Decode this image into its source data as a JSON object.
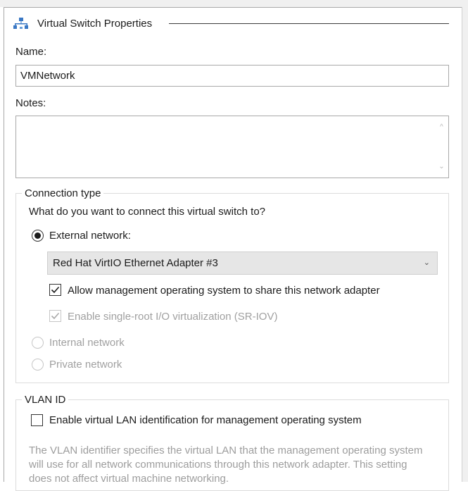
{
  "section": {
    "title": "Virtual Switch Properties",
    "icon": "network-switch-icon"
  },
  "name_field": {
    "label": "Name:",
    "value": "VMNetwork"
  },
  "notes_field": {
    "label": "Notes:",
    "value": ""
  },
  "connection_type": {
    "caption": "Connection type",
    "question": "What do you want to connect this virtual switch to?",
    "external": {
      "label": "External network:",
      "selected": true
    },
    "adapter_dropdown": {
      "value": "Red Hat VirtIO Ethernet Adapter #3"
    },
    "allow_mgmt": {
      "label": "Allow management operating system to share this network adapter",
      "checked": true
    },
    "sriov": {
      "label": "Enable single-root I/O virtualization (SR-IOV)",
      "checked": true,
      "disabled": true
    },
    "internal": {
      "label": "Internal network",
      "selected": false,
      "disabled": true
    },
    "private": {
      "label": "Private network",
      "selected": false,
      "disabled": true
    }
  },
  "vlan": {
    "caption": "VLAN ID",
    "enable": {
      "label": "Enable virtual LAN identification for management operating system",
      "checked": false
    },
    "description": "The VLAN identifier specifies the virtual LAN that the management operating system will use for all network communications through this network adapter. This setting does not affect virtual machine networking."
  },
  "colors": {
    "disabled_text": "#a0a0a0",
    "check_mark": "#1b1b1b"
  }
}
